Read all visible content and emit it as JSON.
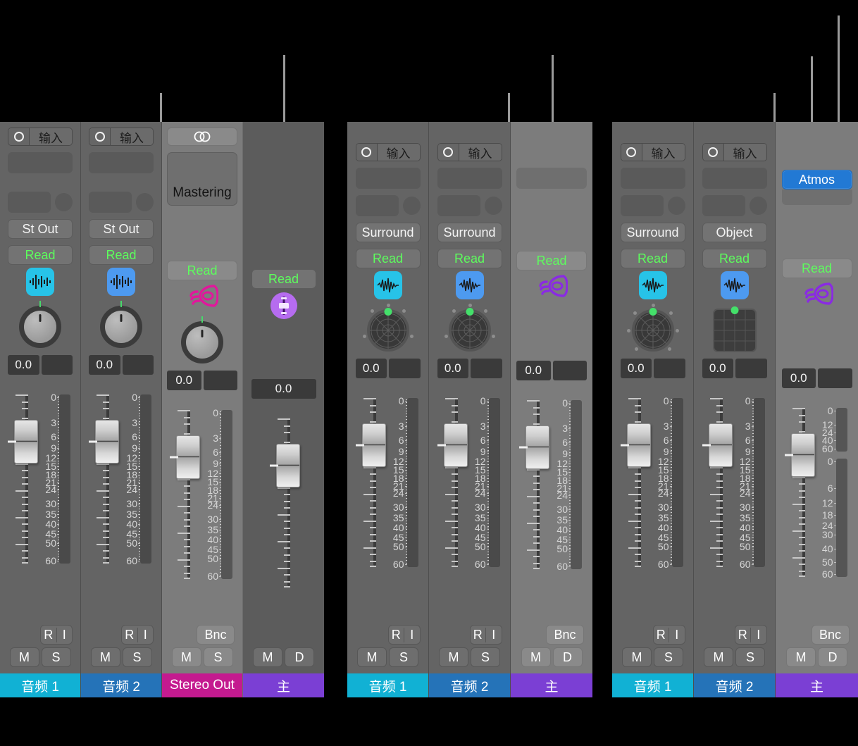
{
  "groups": [
    {
      "id": "stereo-mix",
      "strips": [
        {
          "name": "audio-1",
          "theme": "normal",
          "io": {
            "record_icon": "record-circle-icon",
            "input_label": "输入"
          },
          "output_label": "St Out",
          "automation_label": "Read",
          "icon": "audio-waveform-icon",
          "icon_color": "#27c3e8",
          "panner": "knob",
          "value_left": "0.0",
          "value_right": "",
          "meter_scale": [
            "0",
            "3",
            "6",
            "9",
            "12",
            "15",
            "18",
            "21",
            "24",
            "30",
            "35",
            "40",
            "45",
            "50",
            "60"
          ],
          "buttons_top": [
            "R",
            "I"
          ],
          "buttons_bottom": [
            "M",
            "S"
          ],
          "plate_label": "音频 1",
          "plate_color": "#11b1d4"
        },
        {
          "name": "audio-2",
          "theme": "normal",
          "io": {
            "record_icon": "record-circle-icon",
            "input_label": "输入"
          },
          "output_label": "St Out",
          "automation_label": "Read",
          "icon": "audio-waveform-icon",
          "icon_color": "#4d9af0",
          "panner": "knob",
          "value_left": "0.0",
          "value_right": "",
          "meter_scale": [
            "0",
            "3",
            "6",
            "9",
            "12",
            "15",
            "18",
            "21",
            "24",
            "30",
            "35",
            "40",
            "45",
            "50",
            "60"
          ],
          "buttons_top": [
            "R",
            "I"
          ],
          "buttons_bottom": [
            "M",
            "S"
          ],
          "plate_label": "音频 2",
          "plate_color": "#2573b8"
        },
        {
          "name": "stereo-out",
          "theme": "light",
          "link_icon": "stereo-link-icon",
          "plugin_label": "Mastering",
          "automation_label": "Read",
          "icon": "speaker-output-icon",
          "icon_color": "#e0189c",
          "panner": "knob",
          "value_left": "0.0",
          "value_right": "",
          "meter_scale": [
            "0",
            "3",
            "6",
            "9",
            "12",
            "15",
            "18",
            "21",
            "24",
            "30",
            "35",
            "40",
            "45",
            "50",
            "60"
          ],
          "buttons_top": [
            "Bnc"
          ],
          "buttons_bottom": [
            "M",
            "S"
          ],
          "plate_label": "Stereo Out",
          "plate_color": "#c41a8f"
        },
        {
          "name": "master",
          "theme": "dark",
          "automation_label": "Read",
          "icon": "master-fader-icon",
          "icon_color": "#b66cf0",
          "panner": "none",
          "value_left": "0.0",
          "meter_scale": [],
          "buttons_top": [],
          "buttons_bottom": [
            "M",
            "D"
          ],
          "plate_label": "主",
          "plate_color": "#7b3fd4"
        }
      ]
    },
    {
      "id": "surround-mix",
      "strips": [
        {
          "name": "audio-1",
          "theme": "normal",
          "io": {
            "record_icon": "record-circle-icon",
            "input_label": "输入"
          },
          "output_label": "Surround",
          "automation_label": "Read",
          "icon": "audio-waveform-icon",
          "icon_color": "#27c3e8",
          "panner": "surround",
          "value_left": "0.0",
          "value_right": "",
          "meter_scale": [
            "0",
            "3",
            "6",
            "9",
            "12",
            "15",
            "18",
            "21",
            "24",
            "30",
            "35",
            "40",
            "45",
            "50",
            "60"
          ],
          "buttons_top": [
            "R",
            "I"
          ],
          "buttons_bottom": [
            "M",
            "S"
          ],
          "plate_label": "音频 1",
          "plate_color": "#11b1d4"
        },
        {
          "name": "audio-2",
          "theme": "normal",
          "io": {
            "record_icon": "record-circle-icon",
            "input_label": "输入"
          },
          "output_label": "Surround",
          "automation_label": "Read",
          "icon": "audio-waveform-icon",
          "icon_color": "#4d9af0",
          "panner": "surround",
          "value_left": "0.0",
          "value_right": "",
          "meter_scale": [
            "0",
            "3",
            "6",
            "9",
            "12",
            "15",
            "18",
            "21",
            "24",
            "30",
            "35",
            "40",
            "45",
            "50",
            "60"
          ],
          "buttons_top": [
            "R",
            "I"
          ],
          "buttons_bottom": [
            "M",
            "S"
          ],
          "plate_label": "音频 2",
          "plate_color": "#2573b8"
        },
        {
          "name": "master",
          "theme": "light",
          "automation_label": "Read",
          "icon": "speaker-output-icon",
          "icon_color": "#8a2be2",
          "panner": "none",
          "value_left": "0.0",
          "value_right": "",
          "meter_scale": [
            "0",
            "3",
            "6",
            "9",
            "12",
            "15",
            "18",
            "21",
            "24",
            "30",
            "35",
            "40",
            "45",
            "50",
            "60"
          ],
          "buttons_top": [
            "Bnc"
          ],
          "buttons_bottom": [
            "M",
            "D"
          ],
          "plate_label": "主",
          "plate_color": "#7b3fd4"
        }
      ]
    },
    {
      "id": "atmos-mix",
      "strips": [
        {
          "name": "audio-1",
          "theme": "normal",
          "io": {
            "record_icon": "record-circle-icon",
            "input_label": "输入"
          },
          "output_label": "Surround",
          "automation_label": "Read",
          "icon": "audio-waveform-icon",
          "icon_color": "#27c3e8",
          "panner": "surround",
          "value_left": "0.0",
          "value_right": "",
          "meter_scale": [
            "0",
            "3",
            "6",
            "9",
            "12",
            "15",
            "18",
            "21",
            "24",
            "30",
            "35",
            "40",
            "45",
            "50",
            "60"
          ],
          "buttons_top": [
            "R",
            "I"
          ],
          "buttons_bottom": [
            "M",
            "S"
          ],
          "plate_label": "音频 1",
          "plate_color": "#11b1d4"
        },
        {
          "name": "audio-2",
          "theme": "normal",
          "io": {
            "record_icon": "record-circle-icon",
            "input_label": "输入"
          },
          "output_label": "Object",
          "automation_label": "Read",
          "icon": "audio-waveform-icon",
          "icon_color": "#4d9af0",
          "panner": "object",
          "value_left": "0.0",
          "value_right": "",
          "meter_scale": [
            "0",
            "3",
            "6",
            "9",
            "12",
            "15",
            "18",
            "21",
            "24",
            "30",
            "35",
            "40",
            "45",
            "50",
            "60"
          ],
          "buttons_top": [
            "R",
            "I"
          ],
          "buttons_bottom": [
            "M",
            "S"
          ],
          "plate_label": "音频 2",
          "plate_color": "#2573b8"
        },
        {
          "name": "master",
          "theme": "light",
          "atmos_label": "Atmos",
          "automation_label": "Read",
          "icon": "speaker-output-icon",
          "icon_color": "#8a2be2",
          "panner": "none",
          "value_left": "0.0",
          "value_right": "",
          "meter_scale_top": [
            "0",
            "12",
            "24",
            "40",
            "60"
          ],
          "meter_scale_bottom": [
            "0",
            "6",
            "12",
            "18",
            "24",
            "30",
            "40",
            "50",
            "60"
          ],
          "buttons_top": [
            "Bnc"
          ],
          "buttons_bottom": [
            "M",
            "D"
          ],
          "plate_label": "主",
          "plate_color": "#7b3fd4"
        }
      ]
    }
  ],
  "colors": {
    "strip_bg": "#646464",
    "strip_bg_light": "#7c7c7c",
    "strip_bg_dark": "#5c5c5c",
    "read_green": "#5dfd5d",
    "atmos_blue": "#2279d4",
    "panner_green": "#44e06a",
    "callout_line": "#9a9a9a",
    "page_bg": "#000000"
  }
}
